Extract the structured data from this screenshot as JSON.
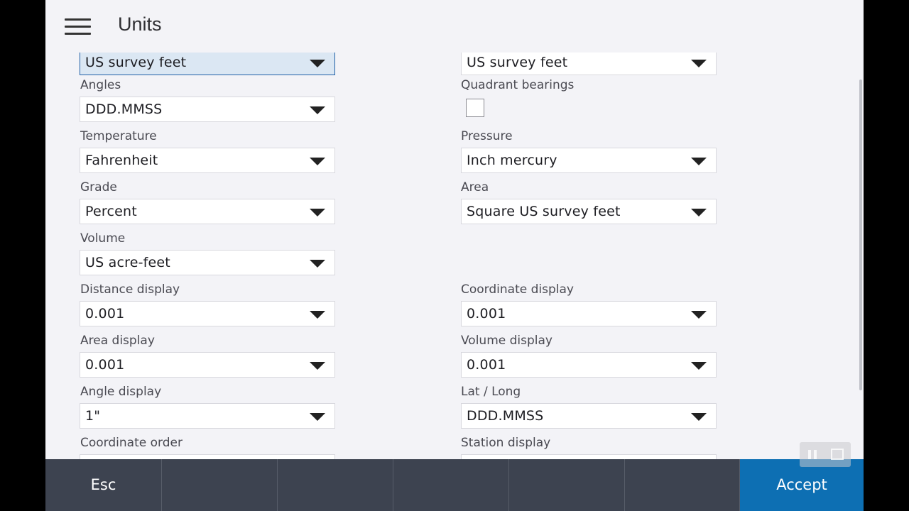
{
  "header": {
    "title": "Units"
  },
  "fields": {
    "distance_left": {
      "value": "US survey feet"
    },
    "distance_right": {
      "value": "US survey feet"
    },
    "angles": {
      "label": "Angles",
      "value": "DDD.MMSS"
    },
    "quadrant_bearings": {
      "label": "Quadrant bearings",
      "checked": false
    },
    "temperature": {
      "label": "Temperature",
      "value": "Fahrenheit"
    },
    "pressure": {
      "label": "Pressure",
      "value": "Inch mercury"
    },
    "grade": {
      "label": "Grade",
      "value": "Percent"
    },
    "area": {
      "label": "Area",
      "value": "Square US survey feet"
    },
    "volume": {
      "label": "Volume",
      "value": "US acre-feet"
    },
    "distance_display": {
      "label": "Distance display",
      "value": "0.001"
    },
    "coordinate_display": {
      "label": "Coordinate display",
      "value": "0.001"
    },
    "area_display": {
      "label": "Area display",
      "value": "0.001"
    },
    "volume_display": {
      "label": "Volume display",
      "value": "0.001"
    },
    "angle_display": {
      "label": "Angle display",
      "value": "1\""
    },
    "lat_long": {
      "label": "Lat / Long",
      "value": "DDD.MMSS"
    },
    "coordinate_order": {
      "label": "Coordinate order"
    },
    "station_display": {
      "label": "Station display"
    }
  },
  "footer": {
    "esc_label": "Esc",
    "accept_label": "Accept"
  },
  "colors": {
    "accent": "#0d6fb3",
    "footer_bg": "#3d4350",
    "page_bg": "#f3f3f7"
  }
}
